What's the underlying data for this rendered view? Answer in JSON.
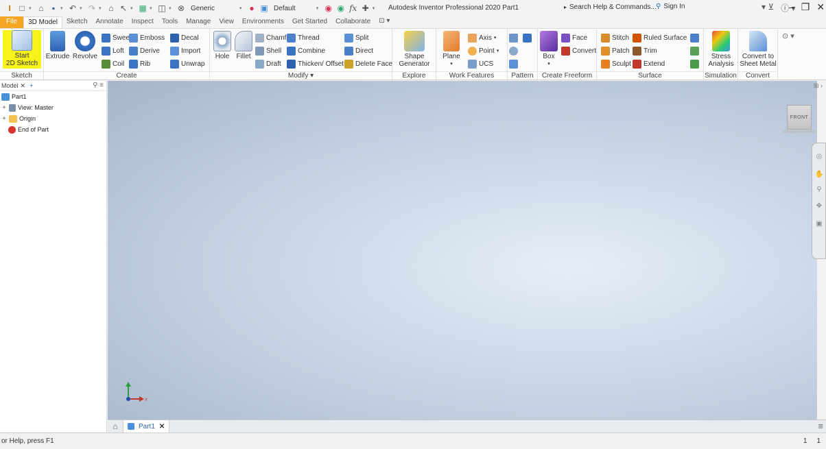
{
  "titlebar": {
    "material": "Generic",
    "appearance": "Default",
    "app_title": "Autodesk Inventor Professional 2020   Part1",
    "search_help": "Search Help & Commands...",
    "sign_in": "Sign In"
  },
  "tabs": [
    "File",
    "3D Model",
    "Sketch",
    "Annotate",
    "Inspect",
    "Tools",
    "Manage",
    "View",
    "Environments",
    "Get Started",
    "Collaborate"
  ],
  "ribbon": {
    "sketch": {
      "title": "Sketch",
      "start_sketch_line1": "Start",
      "start_sketch_line2": "2D Sketch"
    },
    "create": {
      "title": "Create",
      "extrude": "Extrude",
      "revolve": "Revolve",
      "sweep": "Sweep",
      "loft": "Loft",
      "coil": "Coil",
      "emboss": "Emboss",
      "derive": "Derive",
      "rib": "Rib",
      "decal": "Decal",
      "import": "Import",
      "unwrap": "Unwrap"
    },
    "modify": {
      "title": "Modify ▾",
      "hole": "Hole",
      "fillet": "Fillet",
      "chamfer": "Chamfer",
      "shell": "Shell",
      "draft": "Draft",
      "thread": "Thread",
      "combine": "Combine",
      "thicken": "Thicken/ Offset",
      "split": "Split",
      "direct": "Direct",
      "delete_face": "Delete Face"
    },
    "explore": {
      "title": "Explore",
      "shape_gen_line1": "Shape",
      "shape_gen_line2": "Generator"
    },
    "work_features": {
      "title": "Work Features",
      "plane": "Plane",
      "axis": "Axis",
      "point": "Point",
      "ucs": "UCS"
    },
    "pattern": {
      "title": "Pattern"
    },
    "freeform": {
      "title": "Create Freeform",
      "box": "Box",
      "face": "Face",
      "convert": "Convert"
    },
    "surface": {
      "title": "Surface",
      "stitch": "Stitch",
      "patch": "Patch",
      "sculpt": "Sculpt",
      "ruled": "Ruled Surface",
      "trim": "Trim",
      "extend": "Extend"
    },
    "simulation": {
      "title": "Simulation",
      "stress_line1": "Stress",
      "stress_line2": "Analysis"
    },
    "convert": {
      "title": "Convert",
      "sheet_line1": "Convert to",
      "sheet_line2": "Sheet Metal"
    }
  },
  "browser": {
    "tab_label": "Model",
    "tree": [
      "Part1",
      "View: Master",
      "Origin",
      "End of Part"
    ]
  },
  "viewcube": {
    "label": "FRONT"
  },
  "triad": {
    "x_label": "X"
  },
  "doc_tab": {
    "label": "Part1"
  },
  "status": {
    "help": "or Help, press F1",
    "count1": "1",
    "count2": "1"
  }
}
